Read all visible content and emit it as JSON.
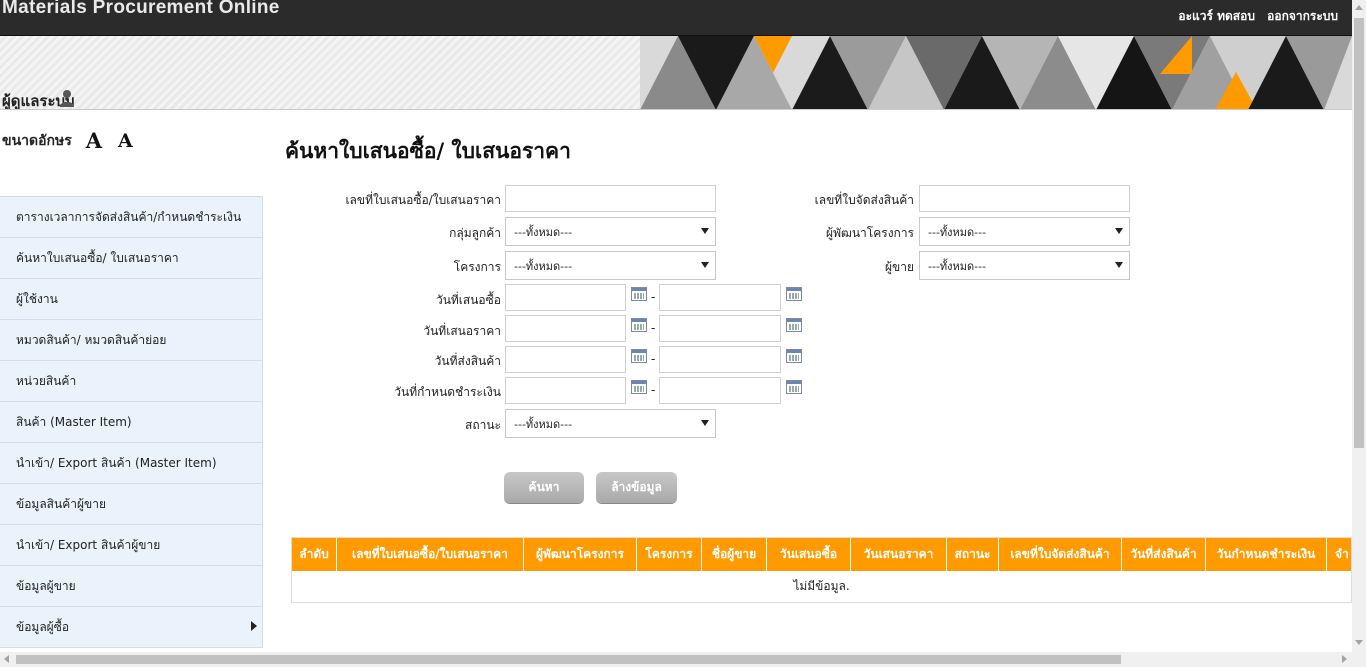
{
  "header": {
    "app_title": "Materials Procurement Online",
    "user_name": "อะแวร์ ทดสอบ",
    "logout": "ออกจากระบบ"
  },
  "banner": {
    "section_title": "ผู้ดูแลระบบ"
  },
  "font_size": {
    "label": "ขนาดอักษร",
    "increase": "A",
    "decrease": "A"
  },
  "sidebar": {
    "items": [
      {
        "label": "ตารางเวลาการจัดส่งสินค้า/กำหนดชำระเงิน"
      },
      {
        "label": "ค้นหาใบเสนอซื้อ/ ใบเสนอราคา"
      },
      {
        "label": "ผู้ใช้งาน"
      },
      {
        "label": "หมวดสินค้า/ หมวดสินค้าย่อย"
      },
      {
        "label": "หน่วยสินค้า"
      },
      {
        "label": "สินค้า (Master Item)"
      },
      {
        "label": "นำเข้า/ Export สินค้า (Master Item)"
      },
      {
        "label": "ข้อมูลสินค้าผู้ขาย"
      },
      {
        "label": "นำเข้า/ Export สินค้าผู้ขาย"
      },
      {
        "label": "ข้อมูลผู้ขาย"
      },
      {
        "label": "ข้อมูลผู้ซื้อ"
      }
    ]
  },
  "main": {
    "title": "ค้นหาใบเสนอซื้อ/ ใบเสนอราคา",
    "form": {
      "po_number_label": "เลขที่ใบเสนอซื้อ/ใบเสนอราคา",
      "delivery_no_label": "เลขที่ใบจัดส่งสินค้า",
      "customer_group_label": "กลุ่มลูกค้า",
      "customer_group_value": "---ทั้งหมด---",
      "developer_label": "ผู้พัฒนาโครงการ",
      "developer_value": "---ทั้งหมด---",
      "project_label": "โครงการ",
      "project_value": "---ทั้งหมด---",
      "seller_label": "ผู้ขาย",
      "seller_value": "---ทั้งหมด---",
      "po_date_label": "วันที่เสนอซื้อ",
      "quote_date_label": "วันที่เสนอราคา",
      "delivery_date_label": "วันที่ส่งสินค้า",
      "payment_due_label": "วันที่กำหนดชำระเงิน",
      "status_label": "สถานะ",
      "status_value": "---ทั้งหมด---",
      "range_sep": "-"
    },
    "buttons": {
      "search": "ค้นหา",
      "clear": "ล้างข้อมูล"
    },
    "table": {
      "columns": [
        "ลำดับ",
        "เลขที่ใบเสนอซื้อ/ใบเสนอราคา",
        "ผู้พัฒนาโครงการ",
        "โครงการ",
        "ชื่อผู้ขาย",
        "วันเสนอซื้อ",
        "วันเสนอราคา",
        "สถานะ",
        "เลขที่ใบจัดส่งสินค้า",
        "วันที่ส่งสินค้า",
        "วันกำหนดชำระเงิน",
        "จำ"
      ],
      "empty_message": "ไม่มีข้อมูล."
    }
  },
  "colors": {
    "accent": "#ff9a00",
    "topbar": "#2b2b2b",
    "sidebar_bg": "#eaf3fb"
  }
}
